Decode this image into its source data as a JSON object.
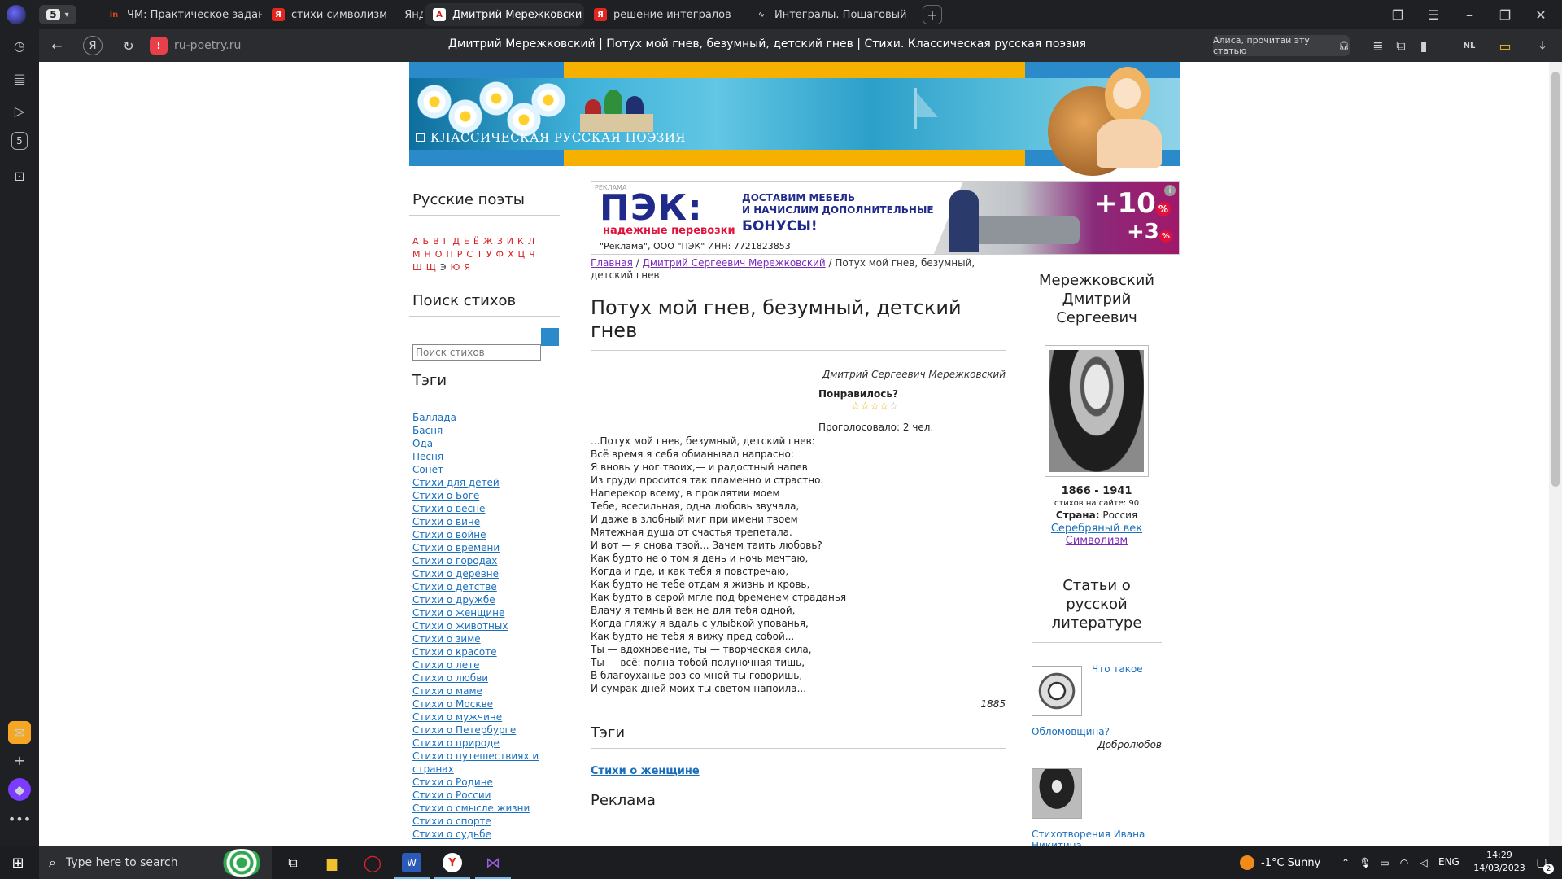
{
  "browser": {
    "tabs": [
      {
        "label": "ЧМ: Практическое задани",
        "fav": "in",
        "color": "#d9431e"
      },
      {
        "label": "стихи символизм — Янде",
        "fav": "Я",
        "color": "#e52620"
      },
      {
        "label": "Дмитрий Мережковски",
        "fav": "A",
        "color": "#c81e1e",
        "active": true
      },
      {
        "label": "решение интегралов — Я",
        "fav": "Я",
        "color": "#e52620"
      },
      {
        "label": "Интегралы. Пошаговый к",
        "fav": "∿",
        "color": "#555"
      }
    ],
    "workspace_badge": "5",
    "address": "ru-poetry.ru",
    "page_title": "Дмитрий Мережковский | Потух мой гнев, безумный, детский гнев | Стихи. Классическая русская поэзия",
    "alice_button": "Алиса, прочитай эту статью"
  },
  "site": {
    "banner_title": "КЛАССИЧЕСКАЯ РУССКАЯ ПОЭЗИЯ",
    "left": {
      "poets_heading": "Русские поэты",
      "letters_rows": [
        [
          "А",
          "Б",
          "В",
          "Г",
          "Д",
          "Е",
          "Ё",
          "Ж",
          "З",
          "И",
          "К",
          "Л"
        ],
        [
          "М",
          "Н",
          "О",
          "П",
          "Р",
          "С",
          "Т",
          "У",
          "Ф",
          "Х",
          "Ц",
          "Ч"
        ],
        [
          "Ш",
          "Щ",
          "Э",
          "Ю",
          "Я"
        ]
      ],
      "search_heading": "Поиск стихов",
      "search_placeholder": "Поиск стихов",
      "tags_heading": "Тэги",
      "tags": [
        "Баллада",
        "Басня",
        "Ода",
        "Песня",
        "Сонет",
        "Стихи для детей",
        "Стихи о Боге",
        "Стихи о весне",
        "Стихи о вине",
        "Стихи о войне",
        "Стихи о времени",
        "Стихи о городах",
        "Стихи о деревне",
        "Стихи о детстве",
        "Стихи о дружбе",
        "Стихи о женщине",
        "Стихи о животных",
        "Стихи о зиме",
        "Стихи о красоте",
        "Стихи о лете",
        "Стихи о любви",
        "Стихи о маме",
        "Стихи о Москве",
        "Стихи о мужчине",
        "Стихи о Петербурге",
        "Стихи о природе",
        "Стихи о путешествиях и странах",
        "Стихи о Родине",
        "Стихи о России",
        "Стихи о смысле жизни",
        "Стихи о спорте",
        "Стихи о судьбе"
      ]
    },
    "ad": {
      "label": "РЕКЛАМА",
      "logo": "ПЭК:",
      "slogan": "надежные перевозки",
      "line1": "ДОСТАВИМ МЕБЕЛЬ",
      "line2": "И НАЧИСЛИМ ДОПОЛНИТЕЛЬНЫЕ",
      "line3": "БОНУСЫ!",
      "legal": "\"Реклама\", ООО \"ПЭК\" ИНН: 7721823853",
      "big": "+10",
      "small": "+3",
      "pct": "%"
    },
    "breadcrumb": {
      "home": "Главная",
      "sep": "/",
      "author": "Дмитрий Сергеевич Мережковский",
      "current": "Потух мой гнев, безумный, детский гнев"
    },
    "poem": {
      "title": "Потух мой гнев, безумный, детский гнев",
      "author": "Дмитрий Сергеевич Мережковский",
      "liked_label": "Понравилось?",
      "rating": 4,
      "votes": "Проголосовало: 2 чел.",
      "text": "...Потух мой гнев, безумный, детский гнев:\nВсё время я себя обманывал напрасно:\nЯ вновь у ног твоих,— и радостный напев\nИз груди просится так пламенно и страстно.\nНаперекор всему, в проклятии моем\nТебе, всесильная, одна любовь звучала,\nИ даже в злобный миг при имени твоем\nМятежная душа от счастья трепетала.\nИ вот — я снова твой... Зачем таить любовь?\nКак будто не о том я день и ночь мечтаю,\nКогда и где, и как тебя я повстречаю,\nКак будто не тебе отдам я жизнь и кровь,\nКак будто в серой мгле под бременем страданья\nВлачу я темный век не для тебя одной,\nКогда гляжу я вдаль с улыбкой упованья,\nКак будто не тебя я вижу пред собой...\nТы — вдохновение, ты — творческая сила,\nТы — всё: полна тобой полуночная тишь,\nВ благоуханье роз со мной ты говоришь,\nИ сумрак дней моих ты светом напоила...",
      "year": "1885",
      "tags_heading": "Тэги",
      "tag": "Стихи о женщине",
      "ads_heading": "Реклама"
    },
    "right": {
      "name": "Мережковский Дмитрий Сергеевич",
      "years": "1866 - 1941",
      "count": "стихов на сайте: 90",
      "country_label": "Страна:",
      "country": "Россия",
      "link1": "Серебряный век",
      "link2": "Символизм",
      "articles_heading": "Статьи о русской литературе",
      "article1_title_a": "Что такое",
      "article1_title_b": "Обломовщина?",
      "article1_author": "Добролюбов",
      "article2_title": "Стихотворения Ивана Никитина"
    }
  },
  "taskbar": {
    "search_placeholder": "Type here to search",
    "weather": "-1°C  Sunny",
    "lang": "ENG",
    "time": "14:29",
    "date": "14/03/2023",
    "notif_count": "2"
  }
}
